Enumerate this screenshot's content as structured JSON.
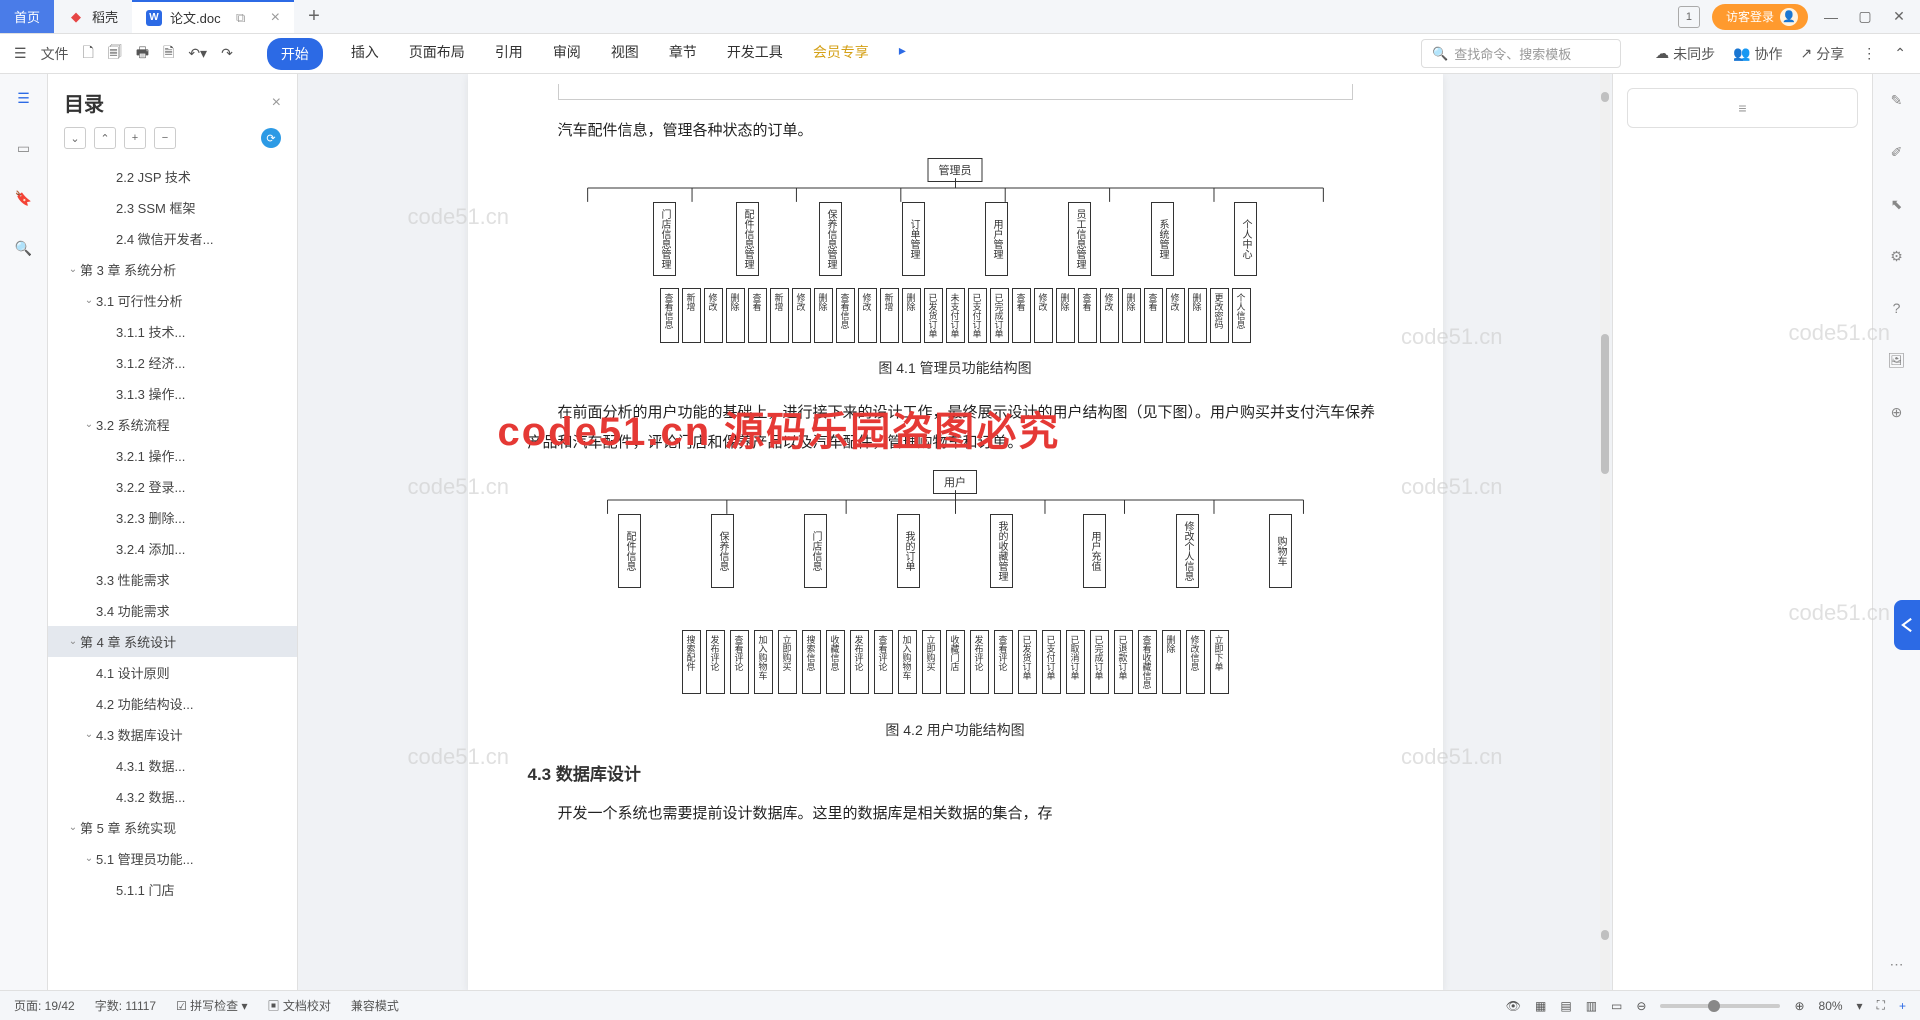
{
  "tabs": {
    "home": "首页",
    "shell": "稻壳",
    "doc": "论文.doc"
  },
  "titlebar": {
    "login": "访客登录",
    "counter": "1"
  },
  "toolbar": {
    "file": "文件"
  },
  "ribbon": [
    "开始",
    "插入",
    "页面布局",
    "引用",
    "审阅",
    "视图",
    "章节",
    "开发工具",
    "会员专享"
  ],
  "search": {
    "placeholder": "查找命令、搜索模板"
  },
  "sync": {
    "unsync": "未同步",
    "collab": "协作",
    "share": "分享"
  },
  "sidebar": {
    "title": "目录"
  },
  "toc": [
    {
      "l": 2,
      "t": "2.2 JSP 技术"
    },
    {
      "l": 2,
      "t": "2.3 SSM 框架"
    },
    {
      "l": 2,
      "t": "2.4 微信开发者..."
    },
    {
      "l": 0,
      "t": "第 3 章  系统分析",
      "c": true
    },
    {
      "l": 1,
      "t": "3.1 可行性分析",
      "c": true
    },
    {
      "l": 2,
      "t": "3.1.1 技术..."
    },
    {
      "l": 2,
      "t": "3.1.2 经济..."
    },
    {
      "l": 2,
      "t": "3.1.3 操作..."
    },
    {
      "l": 1,
      "t": "3.2 系统流程",
      "c": true
    },
    {
      "l": 2,
      "t": "3.2.1 操作..."
    },
    {
      "l": 2,
      "t": "3.2.2 登录..."
    },
    {
      "l": 2,
      "t": "3.2.3 删除..."
    },
    {
      "l": 2,
      "t": "3.2.4 添加..."
    },
    {
      "l": 1,
      "t": "3.3 性能需求"
    },
    {
      "l": 1,
      "t": "3.4 功能需求"
    },
    {
      "l": 0,
      "t": "第 4 章  系统设计",
      "c": true,
      "sel": true
    },
    {
      "l": 1,
      "t": "4.1 设计原则"
    },
    {
      "l": 1,
      "t": "4.2 功能结构设..."
    },
    {
      "l": 1,
      "t": "4.3 数据库设计",
      "c": true
    },
    {
      "l": 2,
      "t": "4.3.1 数据..."
    },
    {
      "l": 2,
      "t": "4.3.2 数据..."
    },
    {
      "l": 0,
      "t": "第 5 章  系统实现",
      "c": true
    },
    {
      "l": 1,
      "t": "5.1 管理员功能...",
      "c": true
    },
    {
      "l": 2,
      "t": "5.1.1 门店"
    }
  ],
  "doc": {
    "p1": "汽车配件信息，管理各种状态的订单。",
    "cap1": "图 4.1  管理员功能结构图",
    "p2": "在前面分析的用户功能的基础上，进行接下来的设计工作，最终展示设计的用户结构图（见下图）。用户购买并支付汽车保养产品和汽车配件，评论门店和保养产品以及汽车配件，管理购物车和订单。",
    "cap2": "图 4.2  用户功能结构图",
    "h43": "4.3  数据库设计",
    "p3": "开发一个系统也需要提前设计数据库。这里的数据库是相关数据的集合，存",
    "dia1_root": "管理员",
    "dia1_l2": [
      "门店信息管理",
      "配件信息管理",
      "保养信息管理",
      "订单管理",
      "用户管理",
      "员工信息管理",
      "系统管理",
      "个人中心"
    ],
    "dia2_root": "用户",
    "dia2_l2": [
      "配件信息",
      "保养信息",
      "门店信息",
      "我的订单",
      "我的收藏管理",
      "用户充值",
      "修改个人信息",
      "购物车"
    ]
  },
  "overlay": {
    "red": "code51.cn 源码乐园盗图必究",
    "wm": "code51.cn"
  },
  "status": {
    "page": "页面: 19/42",
    "words": "字数: 11117",
    "spell": "拼写检查",
    "proof": "文档校对",
    "compat": "兼容模式",
    "zoom": "80%"
  }
}
